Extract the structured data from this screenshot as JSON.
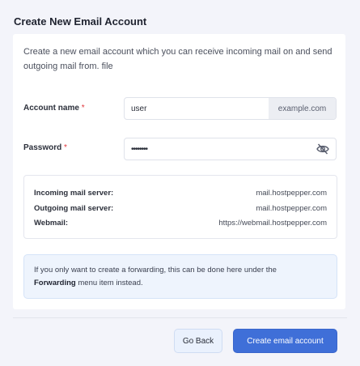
{
  "page": {
    "title": "Create New Email Account",
    "description": "Create a new email account which you can receive incoming mail on and send outgoing mail from. file"
  },
  "form": {
    "account_name": {
      "label": "Account name",
      "required_mark": "*",
      "value": "user",
      "domain_suffix": "example.com"
    },
    "password": {
      "label": "Password",
      "required_mark": "*",
      "value": "••••••••",
      "toggle_icon": "eye-slash-icon"
    }
  },
  "servers": [
    {
      "label": "Incoming mail server:",
      "value": "mail.hostpepper.com"
    },
    {
      "label": "Outgoing mail server:",
      "value": "mail.hostpepper.com"
    },
    {
      "label": "Webmail:",
      "value": "https://webmail.hostpepper.com"
    }
  ],
  "info": {
    "text_before": "If you only want to create a forwarding, this can be done here under the ",
    "highlight": "Forwarding",
    "text_after": " menu item instead."
  },
  "buttons": {
    "back": "Go Back",
    "create": "Create email account"
  },
  "colors": {
    "accent": "#3f6fd8",
    "required": "#e0363b",
    "info_bg": "#eef4fd"
  }
}
